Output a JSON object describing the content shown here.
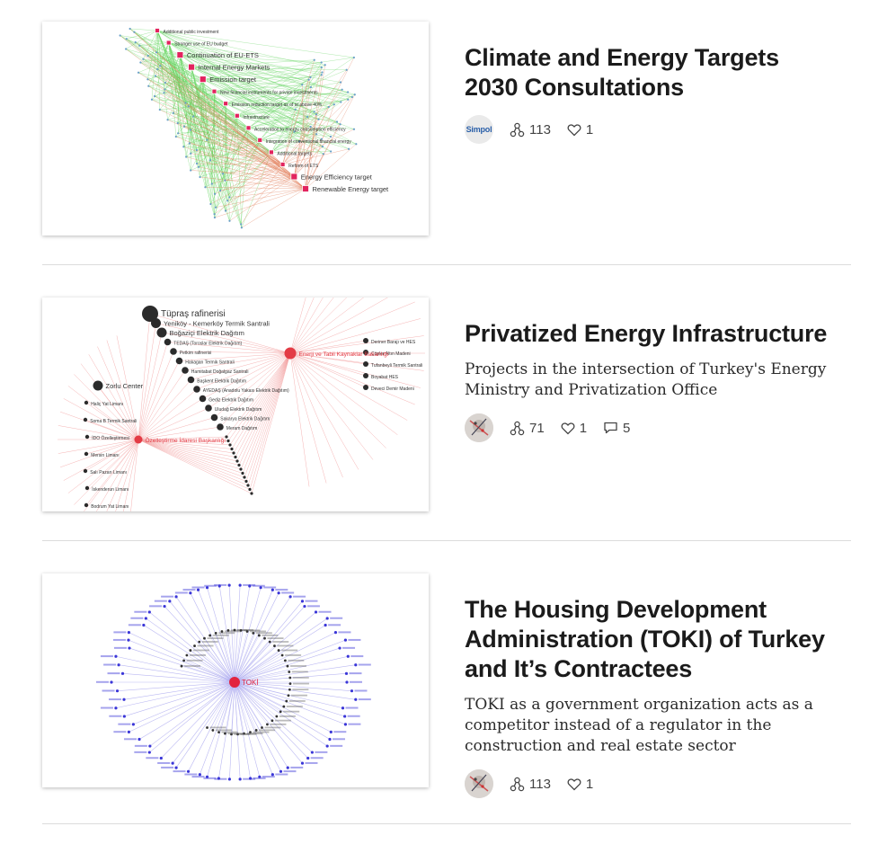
{
  "cards": [
    {
      "title": "Climate and Energy Targets 2030 Consultations",
      "description": "",
      "avatar": {
        "type": "logo",
        "text": "Simpol"
      },
      "stats": {
        "forks": "113",
        "likes": "1"
      },
      "thumbnail": {
        "edge_colors": [
          "#5ed35a",
          "#e0744f"
        ],
        "hub_color": "#e2245e",
        "nodes": [
          "Additional public investment",
          "Stronger use of EU budget",
          "Continuation of EU-ETS",
          "Internal Energy Markets",
          "Emission target",
          "New financial instruments for private investments",
          "Emission reduction target as of at above 40%",
          "Infrastructure",
          "Acceleration to energy consumption efficiency",
          "Integration of conventional financial energy",
          "Additional targets",
          "Reform of ETS",
          "Energy Efficiency target",
          "Renewable Energy target"
        ]
      }
    },
    {
      "title": "Privatized Energy Infrastructure",
      "description": "Projects in the intersection of Turkey's Energy Ministry and Privatization Office",
      "avatar": {
        "type": "photo",
        "text": ""
      },
      "stats": {
        "forks": "71",
        "likes": "1",
        "comments": "5"
      },
      "thumbnail": {
        "edge_color": "#f2a0a0",
        "hub_color": "#e33b45",
        "hubs": [
          "Enerji ve Tabii Kaynaklar Bakanlığı",
          "Özelleştirme İdaresi Başkanlığı"
        ],
        "chain": [
          "Tüpraş rafinerisi",
          "Yeniköy - Kemerköy Termik Santrali",
          "Boğaziçi Elektrik Dağıtım",
          "TEDAŞ (Toroslar Elektrik Dağıtım)",
          "Petkim rafinerisi",
          "Hakagan Termik Santrali",
          "Hamitabat Doğalgaz Santrali",
          "Başkent Elektrik Dağıtım",
          "AYEDAŞ (Anadolu Yakası Elektrik Dağıtım)",
          "Gediz Elektrik Dağıtım",
          "Uludağ Elektrik Dağıtım",
          "Sakarya Elektrik Dağıtım",
          "Meram Dağıtım"
        ],
        "left": [
          "Zorlu Center",
          "Haliç Yat Limanı",
          "Soma B Termik Santrali",
          "İDO Özelleştirmesi",
          "Mersin Limanı",
          "Salı Pazarı Limanı",
          "İskenderun Limanı",
          "Bodrum Yat Limanı"
        ],
        "right": [
          "Deriner Barajı ve HES",
          "Çöpler Altın Madeni",
          "Tufanbeyli Termik Santrali",
          "Boyabat HES",
          "Deveci Demir Madeni"
        ]
      }
    },
    {
      "title": "The Housing Development Administration (TOKI) of Turkey and It’s Contractees",
      "description": "TOKI as a government organization acts as a competitor instead of a regulator in the construction and real estate sector",
      "avatar": {
        "type": "photo",
        "text": ""
      },
      "stats": {
        "forks": "113",
        "likes": "1"
      },
      "thumbnail": {
        "edge_color": "#a9a6ef",
        "node_color": "#3a36d8",
        "hub_color": "#e2243e",
        "hub_label": "TOKİ"
      }
    }
  ],
  "icons": {
    "forks": "fork-icon",
    "likes": "heart-icon",
    "comments": "comment-icon"
  },
  "colors": {
    "title": "#1b1b1b",
    "divider": "#dcdcdc"
  }
}
